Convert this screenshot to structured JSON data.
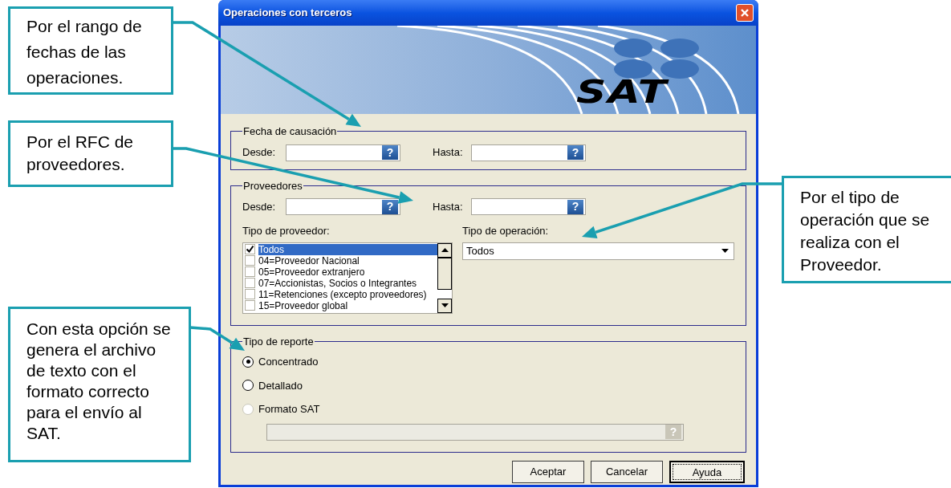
{
  "callouts": [
    {
      "text": "Por el rango de fechas de las operaciones."
    },
    {
      "text": "Por el RFC  de proveedores."
    },
    {
      "text": "Por el tipo de operación que se realiza con el Proveedor."
    },
    {
      "text": "Con esta opción se genera el archivo de texto con el formato correcto para el envío al SAT."
    }
  ],
  "window": {
    "title": "Operaciones con terceros"
  },
  "banner": {
    "logo_text": "SAT"
  },
  "fecha_group": {
    "legend": "Fecha de causación",
    "fields": [
      {
        "label": "Desde:",
        "help": "?"
      },
      {
        "label": "Hasta:",
        "help": "?"
      }
    ]
  },
  "proveedores_group": {
    "legend": "Proveedores",
    "fields": [
      {
        "label": "Desde:",
        "help": "?"
      },
      {
        "label": "Hasta:",
        "help": "?"
      }
    ],
    "tipo_proveedor": {
      "label": "Tipo de proveedor:",
      "items": [
        {
          "text": "Todos",
          "checked": true,
          "selected": true
        },
        {
          "text": "04=Proveedor Nacional",
          "checked": false,
          "selected": false
        },
        {
          "text": "05=Proveedor extranjero",
          "checked": false,
          "selected": false
        },
        {
          "text": "07=Accionistas, Socios o Integrantes",
          "checked": false,
          "selected": false
        },
        {
          "text": "11=Retenciones (excepto proveedores)",
          "checked": false,
          "selected": false
        },
        {
          "text": "15=Proveedor global",
          "checked": false,
          "selected": false
        }
      ]
    },
    "tipo_operacion": {
      "label": "Tipo de operación:",
      "value": "Todos"
    }
  },
  "reporte_group": {
    "legend": "Tipo de reporte",
    "options": [
      {
        "label": "Concentrado",
        "selected": true,
        "disabled": false
      },
      {
        "label": "Detallado",
        "selected": false,
        "disabled": false
      },
      {
        "label": "Formato SAT",
        "selected": false,
        "disabled": true
      }
    ],
    "path_field": {
      "disabled": true,
      "help": "?"
    }
  },
  "buttons": [
    {
      "label": "Aceptar",
      "default": false
    },
    {
      "label": "Cancelar",
      "default": false
    },
    {
      "label": "Ayuda",
      "default": true
    }
  ]
}
